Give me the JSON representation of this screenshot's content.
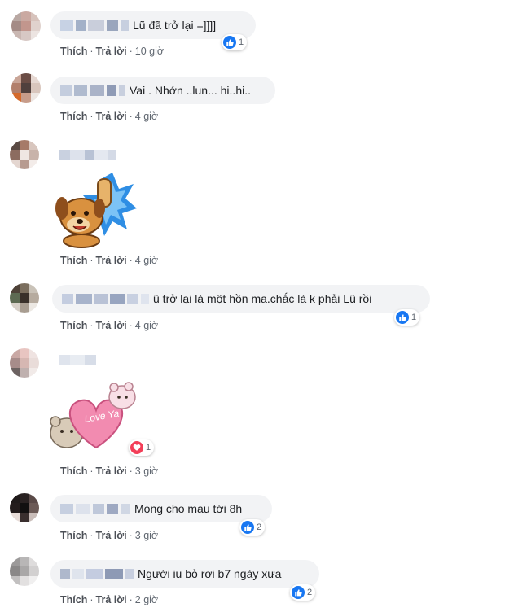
{
  "actions": {
    "like": "Thích",
    "reply": "Trả lời",
    "separator": "·"
  },
  "comments": [
    {
      "text": "Lũ đã trở lại =]]]]",
      "time": "10 giờ",
      "reaction": {
        "type": "like",
        "count": "1"
      }
    },
    {
      "text": "Vai . Nhớn ..lun... hi..hi..",
      "time": "4 giờ"
    },
    {
      "text": "",
      "time": "4 giờ",
      "sticker": "dog-thumbs-up-sticker"
    },
    {
      "text": "ũ trở lại là một hồn ma.chắc là k phải Lũ rồi",
      "time": "4 giờ",
      "reaction": {
        "type": "like",
        "count": "1"
      }
    },
    {
      "text": "",
      "time": "3 giờ",
      "sticker": "love-ya-bears-sticker",
      "reaction": {
        "type": "love",
        "count": "1"
      }
    },
    {
      "text": "Mong cho mau tới 8h",
      "time": "3 giờ",
      "reaction": {
        "type": "like",
        "count": "2"
      }
    },
    {
      "text": "Người iu bỏ rơi b7 ngày xưa",
      "time": "2 giờ",
      "reaction": {
        "type": "like",
        "count": "2"
      }
    }
  ],
  "sticker_text": "Love Ya",
  "colors": {
    "bubble": "#f2f3f5",
    "like": "#1877f2",
    "love": "#f33e58",
    "action": "#4b4f56",
    "time": "#606770"
  }
}
